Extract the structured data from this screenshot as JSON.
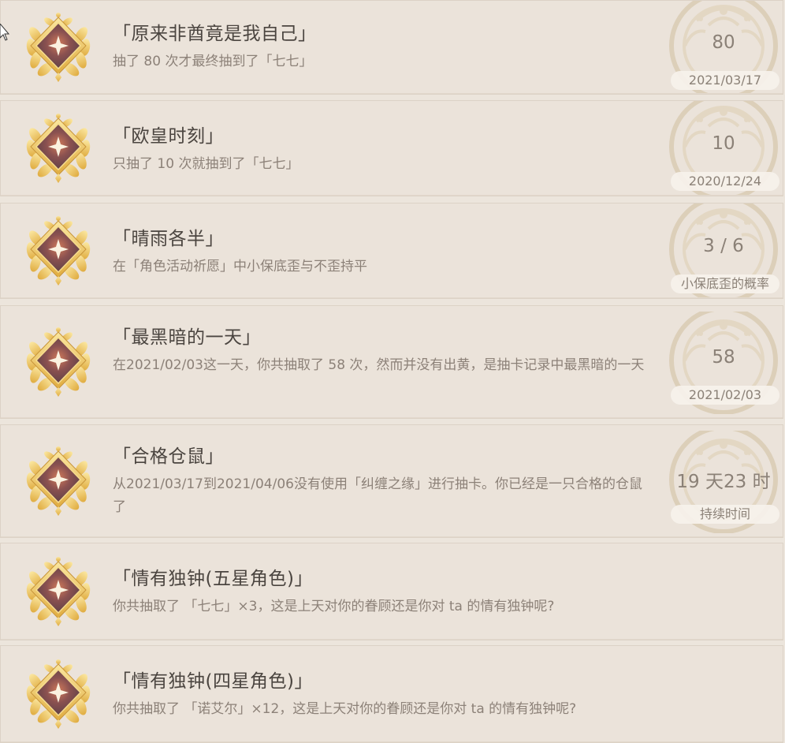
{
  "achievements": [
    {
      "title": "「原来非酋竟是我自己」",
      "desc": "抽了 80 次才最终抽到了「七七」",
      "value": "80",
      "caption": "2021/03/17"
    },
    {
      "title": "「欧皇时刻」",
      "desc": "只抽了 10 次就抽到了「七七」",
      "value": "10",
      "caption": "2020/12/24"
    },
    {
      "title": "「晴雨各半」",
      "desc": "在「角色活动祈愿」中小保底歪与不歪持平",
      "value": "3 / 6",
      "caption": "小保底歪的概率"
    },
    {
      "title": "「最黑暗的一天」",
      "desc": "在2021/02/03这一天，你共抽取了 58 次，然而并没有出黄，是抽卡记录中最黑暗的一天",
      "value": "58",
      "caption": "2021/02/03"
    },
    {
      "title": "「合格仓鼠」",
      "desc": "从2021/03/17到2021/04/06没有使用「纠缠之缘」进行抽卡。你已经是一只合格的仓鼠了",
      "value": "19 天23 时",
      "caption": "持续时间"
    },
    {
      "title": "「情有独钟(五星角色)」",
      "desc": "你共抽取了 「七七」×3，这是上天对你的眷顾还是你对 ta 的情有独钟呢?"
    },
    {
      "title": "「情有独钟(四星角色)」",
      "desc": "你共抽取了 「诺艾尔」×12，这是上天对你的眷顾还是你对 ta 的情有独钟呢?"
    }
  ],
  "colors": {
    "background": "#ece5dc",
    "card": "#ebe3da",
    "title": "#4b4540",
    "text": "#8c8178",
    "gold": "#e9c15a",
    "badge": "#d9ccb6"
  },
  "icons": {
    "medal": "achievement-medal-icon",
    "badge": "badge-emblem",
    "cursor": "mouse-cursor-icon"
  }
}
